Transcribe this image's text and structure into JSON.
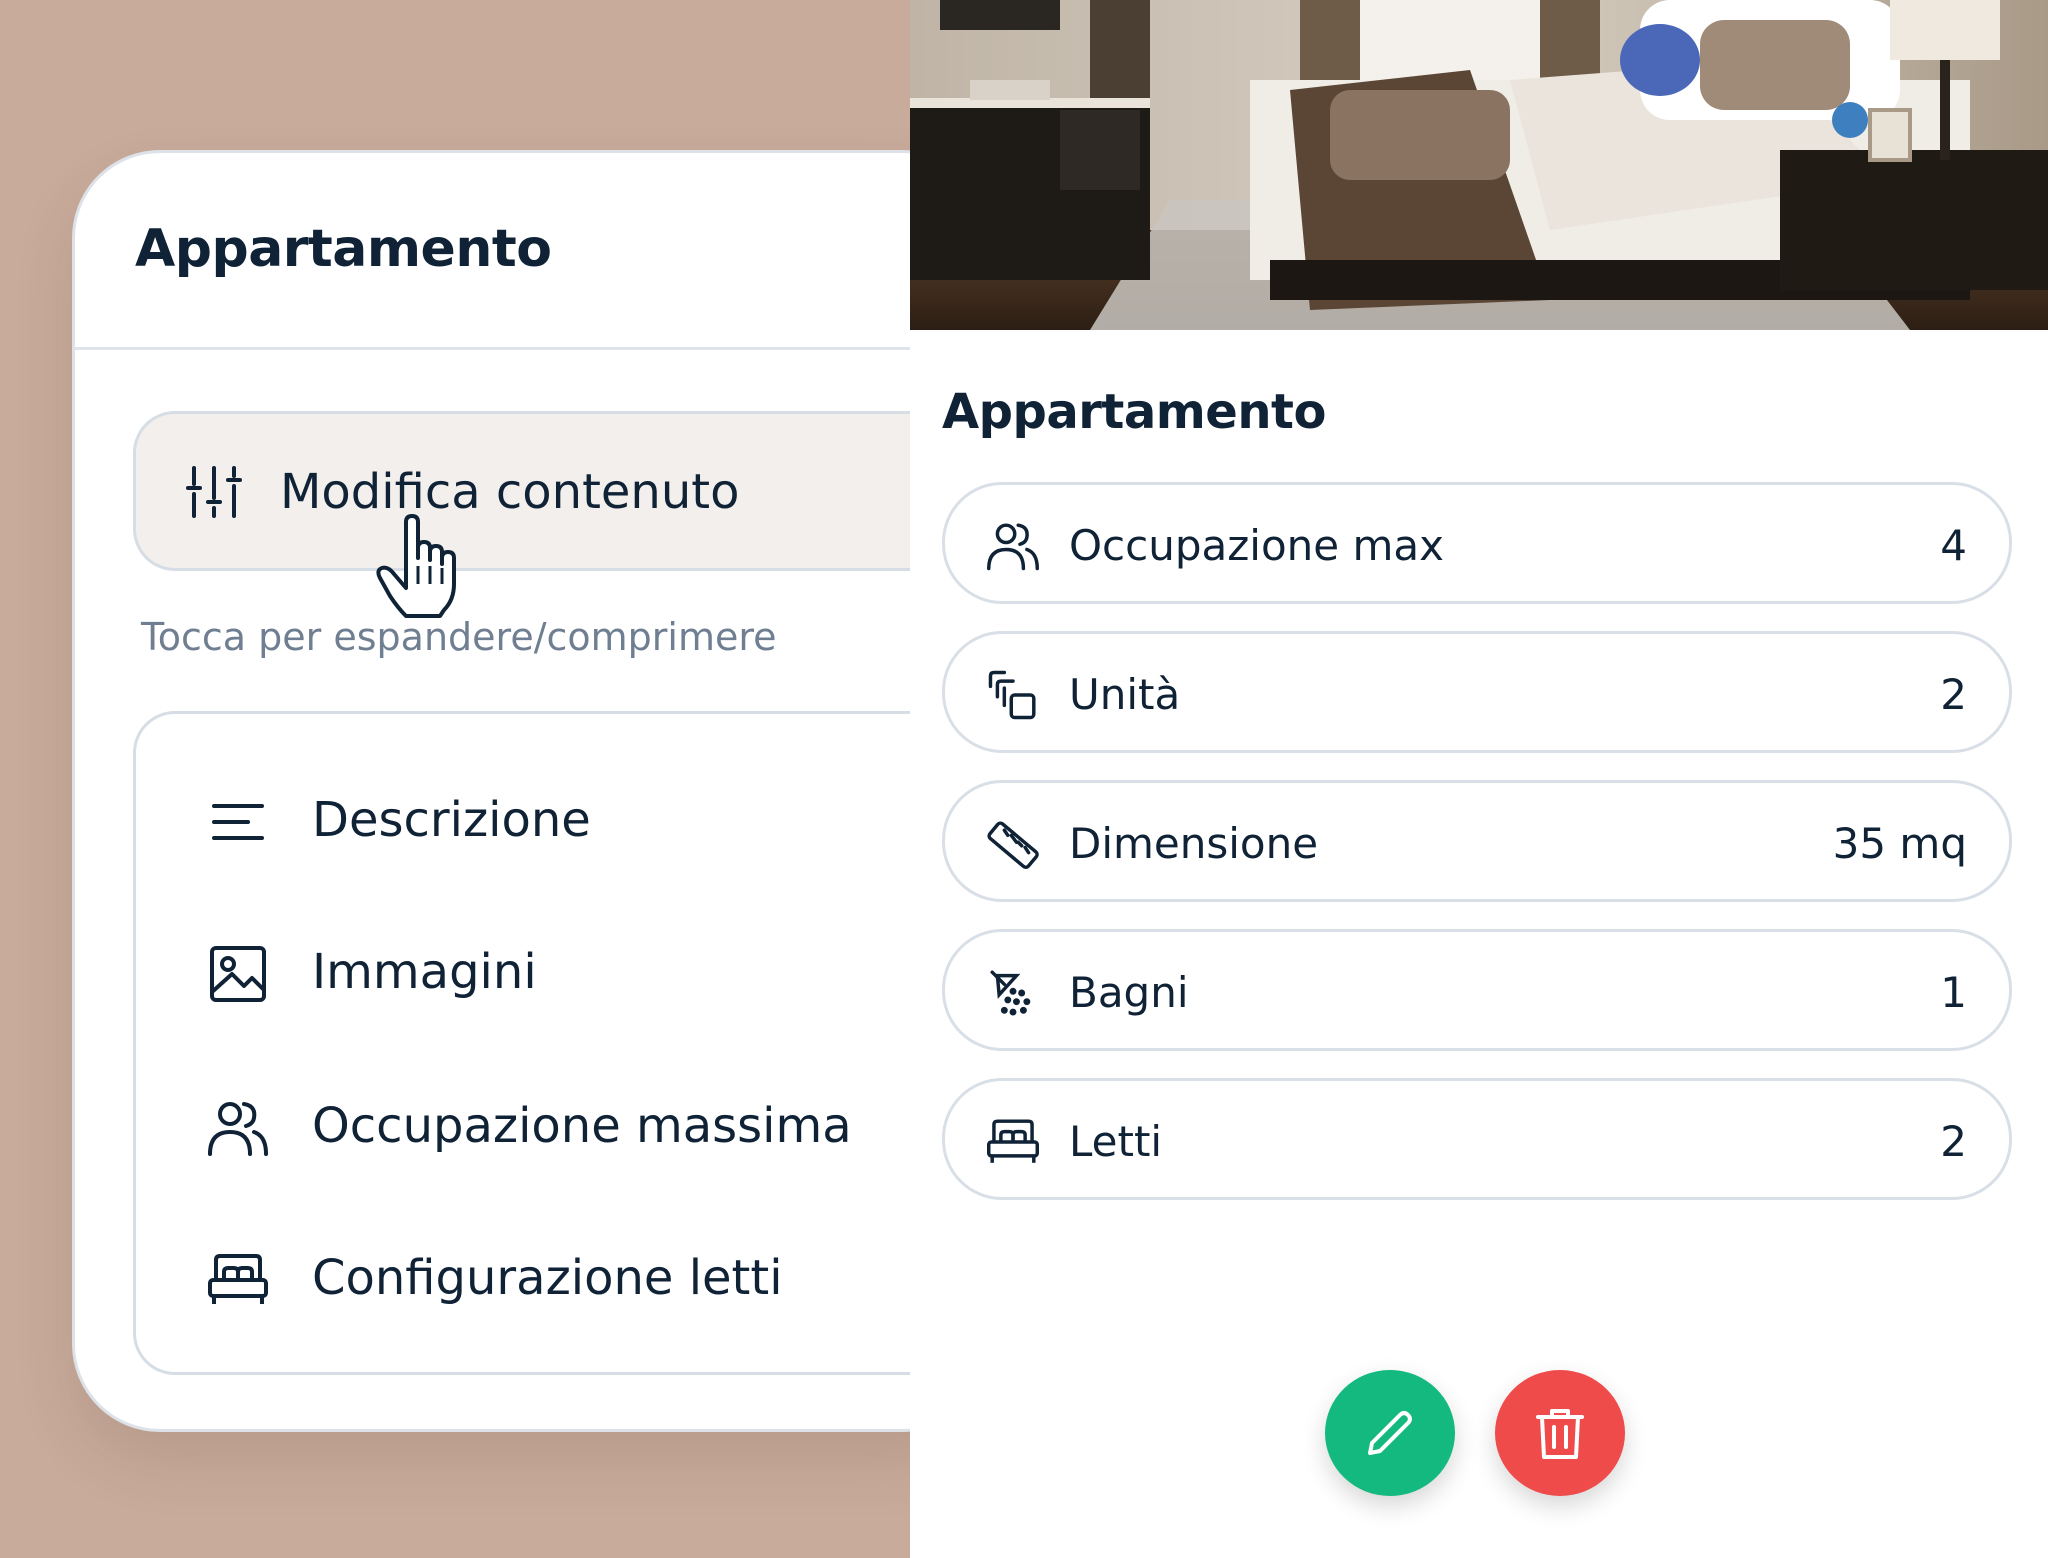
{
  "colors": {
    "background": "#c8ab9a",
    "text": "#0f2236",
    "muted": "#6f7f91",
    "edit_button": "#14b97f",
    "delete_button": "#ef4b4b"
  },
  "editor_card": {
    "title": "Appartamento",
    "edit_content": {
      "label": "Modifica contenuto",
      "icon": "sliders-icon"
    },
    "hint": "Tocca per espandere/comprimere",
    "menu": [
      {
        "label": "Descrizione",
        "icon": "text-lines-icon"
      },
      {
        "label": "Immagini",
        "icon": "image-icon"
      },
      {
        "label": "Occupazione massima",
        "icon": "users-icon"
      },
      {
        "label": "Configurazione letti",
        "icon": "bed-icon"
      }
    ]
  },
  "preview_card": {
    "title": "Appartamento",
    "stats": [
      {
        "label": "Occupazione max",
        "value": "4",
        "icon": "users-icon"
      },
      {
        "label": "Unità",
        "value": "2",
        "icon": "units-icon"
      },
      {
        "label": "Dimensione",
        "value": "35 mq",
        "icon": "ruler-icon"
      },
      {
        "label": "Bagni",
        "value": "1",
        "icon": "shower-icon"
      },
      {
        "label": "Letti",
        "value": "2",
        "icon": "bed-icon"
      }
    ],
    "actions": {
      "edit_icon": "pencil-icon",
      "delete_icon": "trash-icon"
    }
  }
}
